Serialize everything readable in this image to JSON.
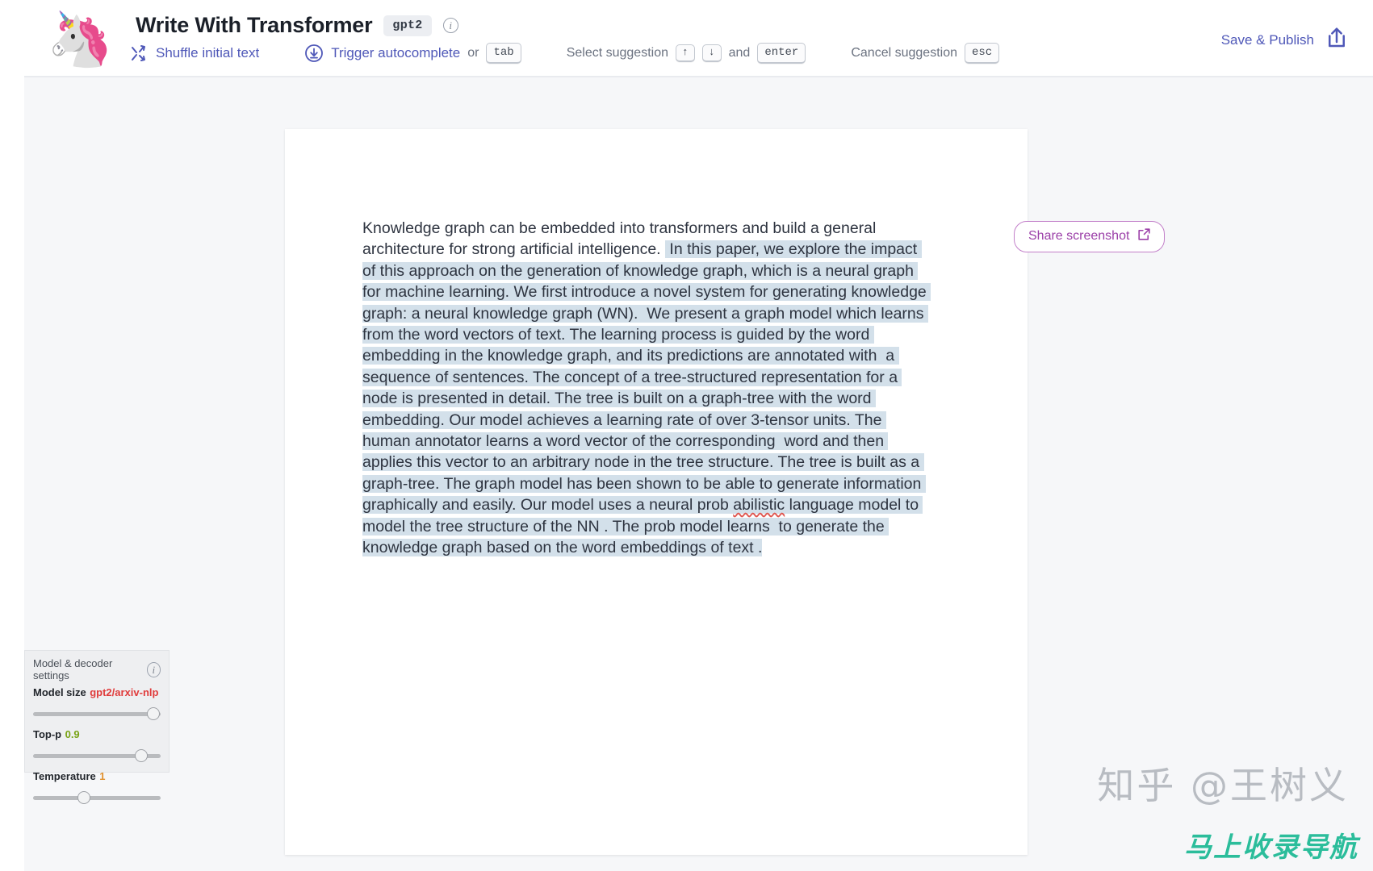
{
  "header": {
    "logo_emoji": "🦄",
    "title": "Write With Transformer",
    "model_badge": "gpt2",
    "info_glyph": "i",
    "shortcuts": {
      "shuffle_label": "Shuffle initial text",
      "autocomplete_label": "Trigger autocomplete",
      "or_label": "or",
      "tab_key": "tab",
      "select_suggestion_label": "Select suggestion",
      "arrow_up_key": "↑",
      "arrow_down_key": "↓",
      "and_label": "and",
      "enter_key": "enter",
      "cancel_suggestion_label": "Cancel suggestion",
      "esc_key": "esc"
    },
    "save_publish_label": "Save & Publish"
  },
  "editor": {
    "plain_prefix": "Knowledge graph can be embedded into transformers and build a general architecture for strong artificial intelligence. ",
    "highlighted_part_1": " In this paper, we explore the impact of this approach on the generation of knowledge graph, which is a neural graph for machine learning. We first introduce a novel system for generating knowledge graph: a neural knowledge graph (WN).  We present a graph model which learns from the word vectors of text. The learning process is guided by the word embedding in the knowledge graph, and its predictions are annotated with  a sequence of sentences. The concept of a tree-structured representation for a node is presented in detail. The tree is built on a graph-tree with the word embedding. Our model achieves a learning rate of over 3-tensor units. The human annotator learns a word vector of the corresponding  word and then applies this vector to an arbitrary node in the tree structure. The tree is built as a graph-tree. The graph model has been shown to be able to generate information graphically and easily. Our model uses a neural prob ",
    "misspelled_word": "abilistic",
    "highlighted_part_2": " language model to model the tree structure of the NN . The prob model learns  to generate the knowledge graph based on the word embeddings of text ."
  },
  "share": {
    "label": "Share screenshot"
  },
  "settings": {
    "panel_title": "Model & decoder settings",
    "info_glyph": "i",
    "model_size_label": "Model size",
    "model_size_value": "gpt2/arxiv-nlp",
    "model_size_thumb_pct": 89,
    "topp_label": "Top-p",
    "topp_value": "0.9",
    "topp_thumb_pct": 80,
    "temperature_label": "Temperature",
    "temperature_value": "1",
    "temperature_thumb_pct": 35
  },
  "watermarks": {
    "zhihu": "知乎 @王树义",
    "green_banner": "马上收录导航"
  },
  "colors": {
    "accent_blue": "#4f58b8",
    "purple": "#9b3fa8",
    "highlight": "#d3e0ea",
    "model_red": "#e03b3b",
    "topp_green": "#79a315",
    "temp_orange": "#e0912f"
  }
}
